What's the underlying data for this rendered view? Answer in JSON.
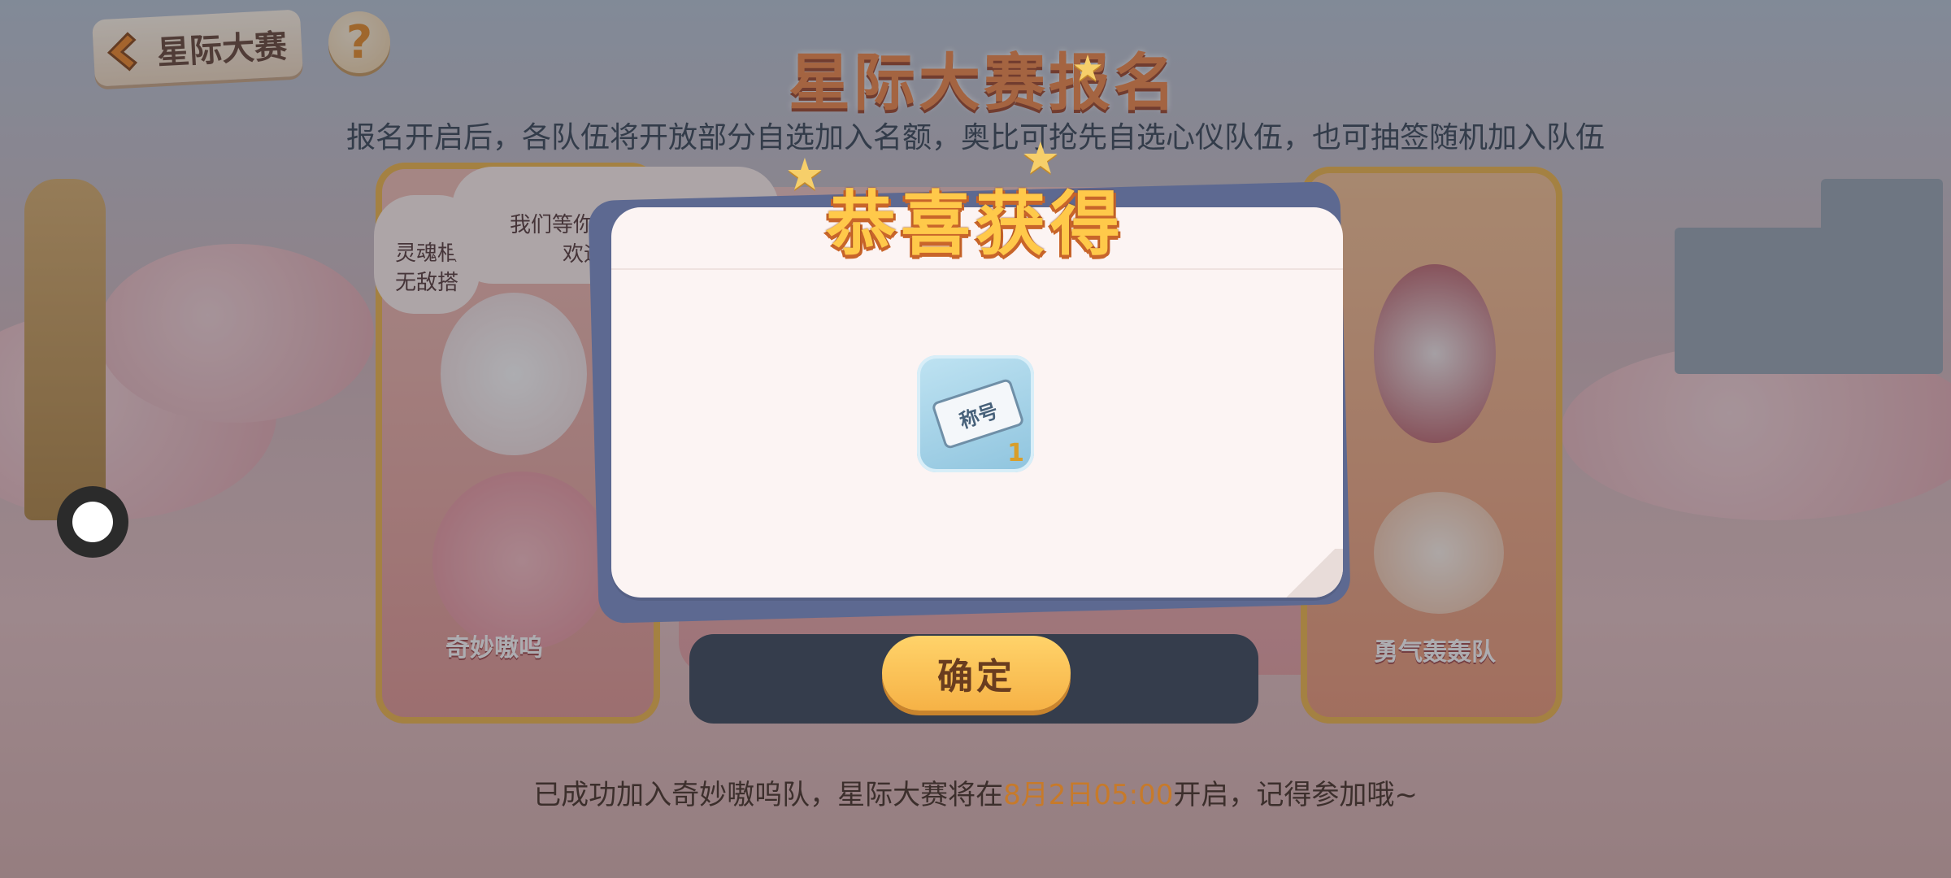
{
  "header": {
    "back_label": "星际大赛",
    "help_label": "?",
    "main_title": "星际大赛报名",
    "subtitle": "报名开启后，各队伍将开放部分自选加入名额，奥比可抢先自选心仪队伍，也可抽签随机加入队伍"
  },
  "teams": {
    "left_name": "奇妙嗷呜",
    "right_name": "勇气轰轰队",
    "bubble_main": "我们等你很久了，搭档\n欢迎加入奇",
    "bubble_side": "灵魂相\n无敌搭"
  },
  "modal": {
    "title": "恭喜获得",
    "item_label": "称号",
    "item_count": "1",
    "confirm_label": "确定"
  },
  "footer": {
    "note_before": "已成功加入奇妙嗷呜队，星际大赛将在",
    "note_date": "8月2日05:00",
    "note_after": "开启，记得参加哦~"
  },
  "colors": {
    "modal_title": "#ffc94a",
    "confirm_button": "#f6b246",
    "highlight": "#c77a2a"
  }
}
